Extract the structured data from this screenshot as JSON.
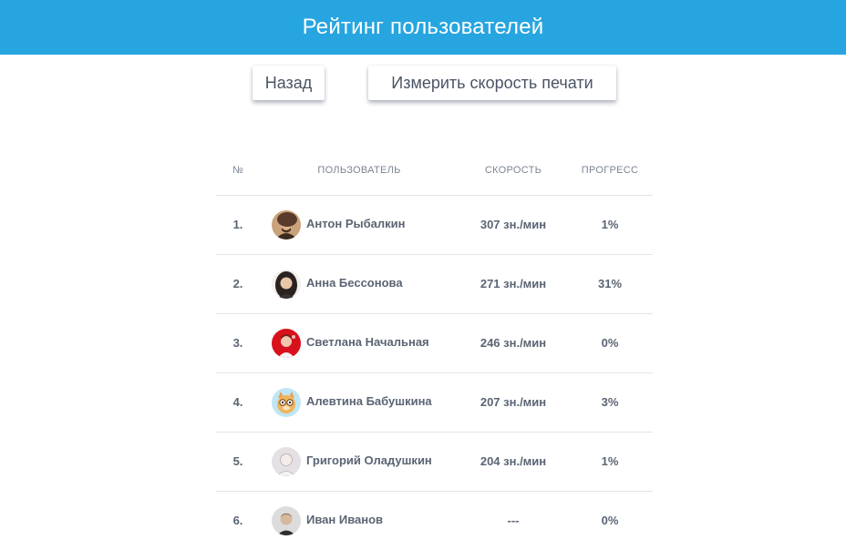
{
  "header": {
    "title": "Рейтинг пользователей"
  },
  "buttons": {
    "back": "Назад",
    "measure": "Измерить скорость печати"
  },
  "table": {
    "columns": [
      "№",
      "ПОЛЬЗОВАТЕЛЬ",
      "СКОРОСТЬ",
      "ПРОГРЕСС"
    ],
    "rows": [
      {
        "rank": "1.",
        "name": "Антон Рыбалкин",
        "speed": "307 зн./мин",
        "progress": "1%",
        "avatar": "avatar-anton"
      },
      {
        "rank": "2.",
        "name": "Анна Бессонова",
        "speed": "271 зн./мин",
        "progress": "31%",
        "avatar": "avatar-anna"
      },
      {
        "rank": "3.",
        "name": "Светлана Начальная",
        "speed": "246 зн./мин",
        "progress": "0%",
        "avatar": "avatar-svetlana"
      },
      {
        "rank": "4.",
        "name": "Алевтина Бабушкина",
        "speed": "207 зн./мин",
        "progress": "3%",
        "avatar": "avatar-alevtina"
      },
      {
        "rank": "5.",
        "name": "Григорий Оладушкин",
        "speed": "204 зн./мин",
        "progress": "1%",
        "avatar": "avatar-grigory"
      },
      {
        "rank": "6.",
        "name": "Иван Иванов",
        "speed": "---",
        "progress": "0%",
        "avatar": "avatar-ivan"
      }
    ]
  },
  "colors": {
    "header_bg": "#27a5e0",
    "text": "#5a6473",
    "muted": "#7c8593",
    "divider": "#e3e5ea"
  }
}
